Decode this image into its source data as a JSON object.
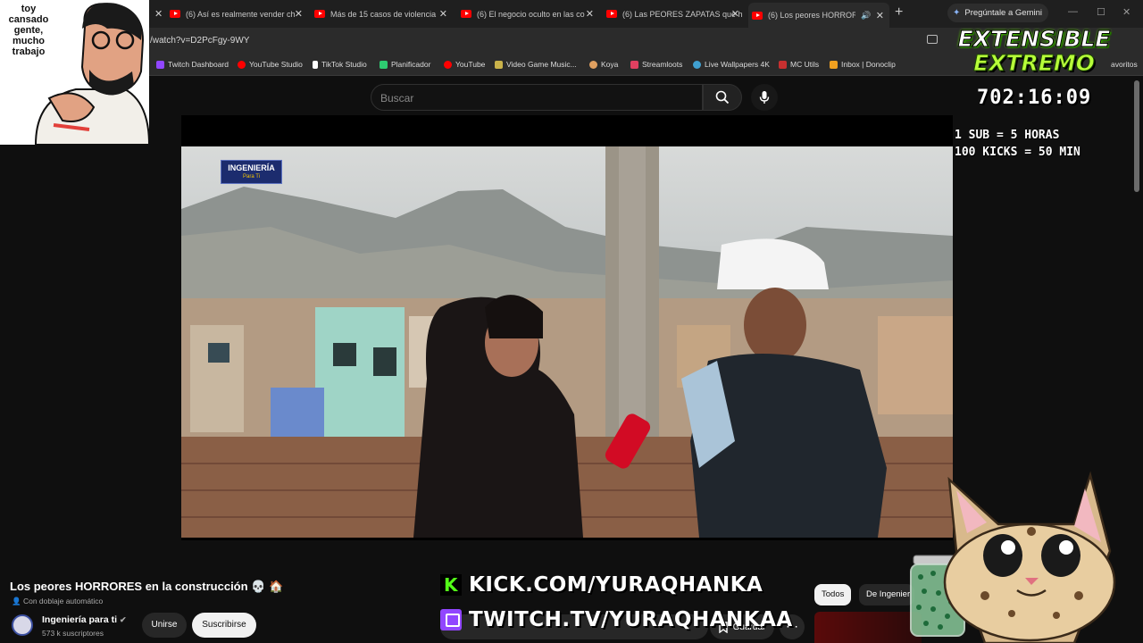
{
  "browser": {
    "tabs": [
      {
        "label": "(6) Así es realmente vender ch"
      },
      {
        "label": "Más de 15 casos de violencia"
      },
      {
        "label": "(6) El negocio oculto en las co"
      },
      {
        "label": "(6) Las PEORES ZAPATAS que h"
      },
      {
        "label": "(6) Los peores HORRORES"
      }
    ],
    "gemini_label": "Pregúntale a Gemini",
    "url": "/watch?v=D2PcFgy-9WY",
    "bookmarks": [
      {
        "label": "Twitch Dashboard",
        "color": "#9146ff"
      },
      {
        "label": "YouTube Studio",
        "color": "#ff0000"
      },
      {
        "label": "TikTok Studio",
        "color": "#ffffff"
      },
      {
        "label": "Planificador",
        "color": "#2ecc71"
      },
      {
        "label": "YouTube",
        "color": "#ff0000"
      },
      {
        "label": "Video Game Music...",
        "color": "#c9b24a"
      },
      {
        "label": "Koya",
        "color": "#e0a060"
      },
      {
        "label": "Streamloots",
        "color": "#e04060"
      },
      {
        "label": "Live Wallpapers 4K",
        "color": "#40a0d0"
      },
      {
        "label": "MC Utils",
        "color": "#c83030"
      },
      {
        "label": "Inbox | Donoclip",
        "color": "#f0a020"
      }
    ],
    "bookmarks_more": "avoritos"
  },
  "youtube": {
    "search_placeholder": "Buscar",
    "video_logo_main": "INGENIERÍA",
    "video_logo_sub": "Para Ti",
    "title": "Los peores HORRORES en la construcción 💀 🏠",
    "dub_note": "Con doblaje automático",
    "channel_name": "Ingeniería para ti",
    "subscribers": "573 k suscriptores",
    "join_label": "Unirse",
    "subscribe_label": "Suscribirse",
    "save_label": "Guardar",
    "chips": [
      "Todos",
      "De Ingenier"
    ]
  },
  "overlay": {
    "cam_text": "toy cansado gente, mucho trabajo",
    "event_title_1": "EXTENSIBLE",
    "event_title_2": "EXTREMO",
    "timer": "702:16:09",
    "rule_1": "1 SUB = 5 HORAS",
    "rule_2": "100 KICKS = 50 MIN",
    "kick_url": "KICK.COM/YURAQHANKA",
    "twitch_url": "TWITCH.TV/YURAQHANKAA"
  }
}
